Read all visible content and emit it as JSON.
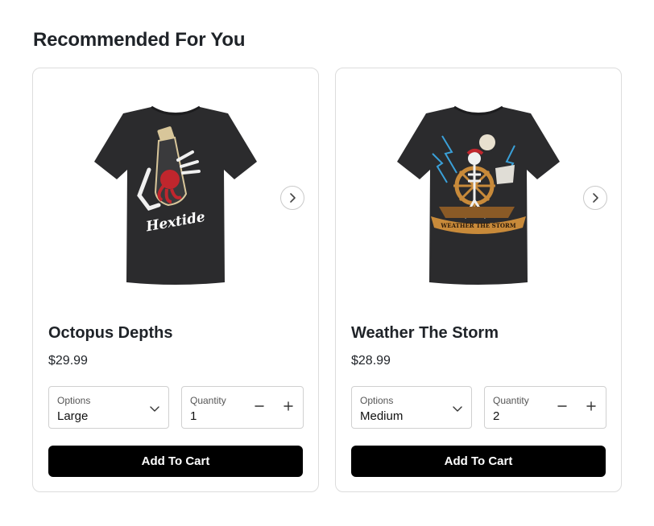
{
  "section": {
    "title": "Recommended For You"
  },
  "products": [
    {
      "name": "Octopus Depths",
      "price": "$29.99",
      "options_label": "Options",
      "options_value": "Large",
      "quantity_label": "Quantity",
      "quantity_value": "1",
      "add_to_cart": "Add To Cart",
      "image_brand_text": "Hextide"
    },
    {
      "name": "Weather The Storm",
      "price": "$28.99",
      "options_label": "Options",
      "options_value": "Medium",
      "quantity_label": "Quantity",
      "quantity_value": "2",
      "add_to_cart": "Add To Cart",
      "image_banner_text": "WEATHER THE STORM"
    }
  ],
  "colors": {
    "shirt": "#2b2b2d",
    "button": "#000000",
    "border": "#dcdcdc",
    "octopus": "#c0262d",
    "bottle": "#d8c69a",
    "lightning": "#3aa0d8",
    "wood": "#c88a3a"
  },
  "icons": {
    "next": "chevron-right-icon",
    "dropdown": "chevron-down-icon",
    "minus": "minus-icon",
    "plus": "plus-icon"
  }
}
